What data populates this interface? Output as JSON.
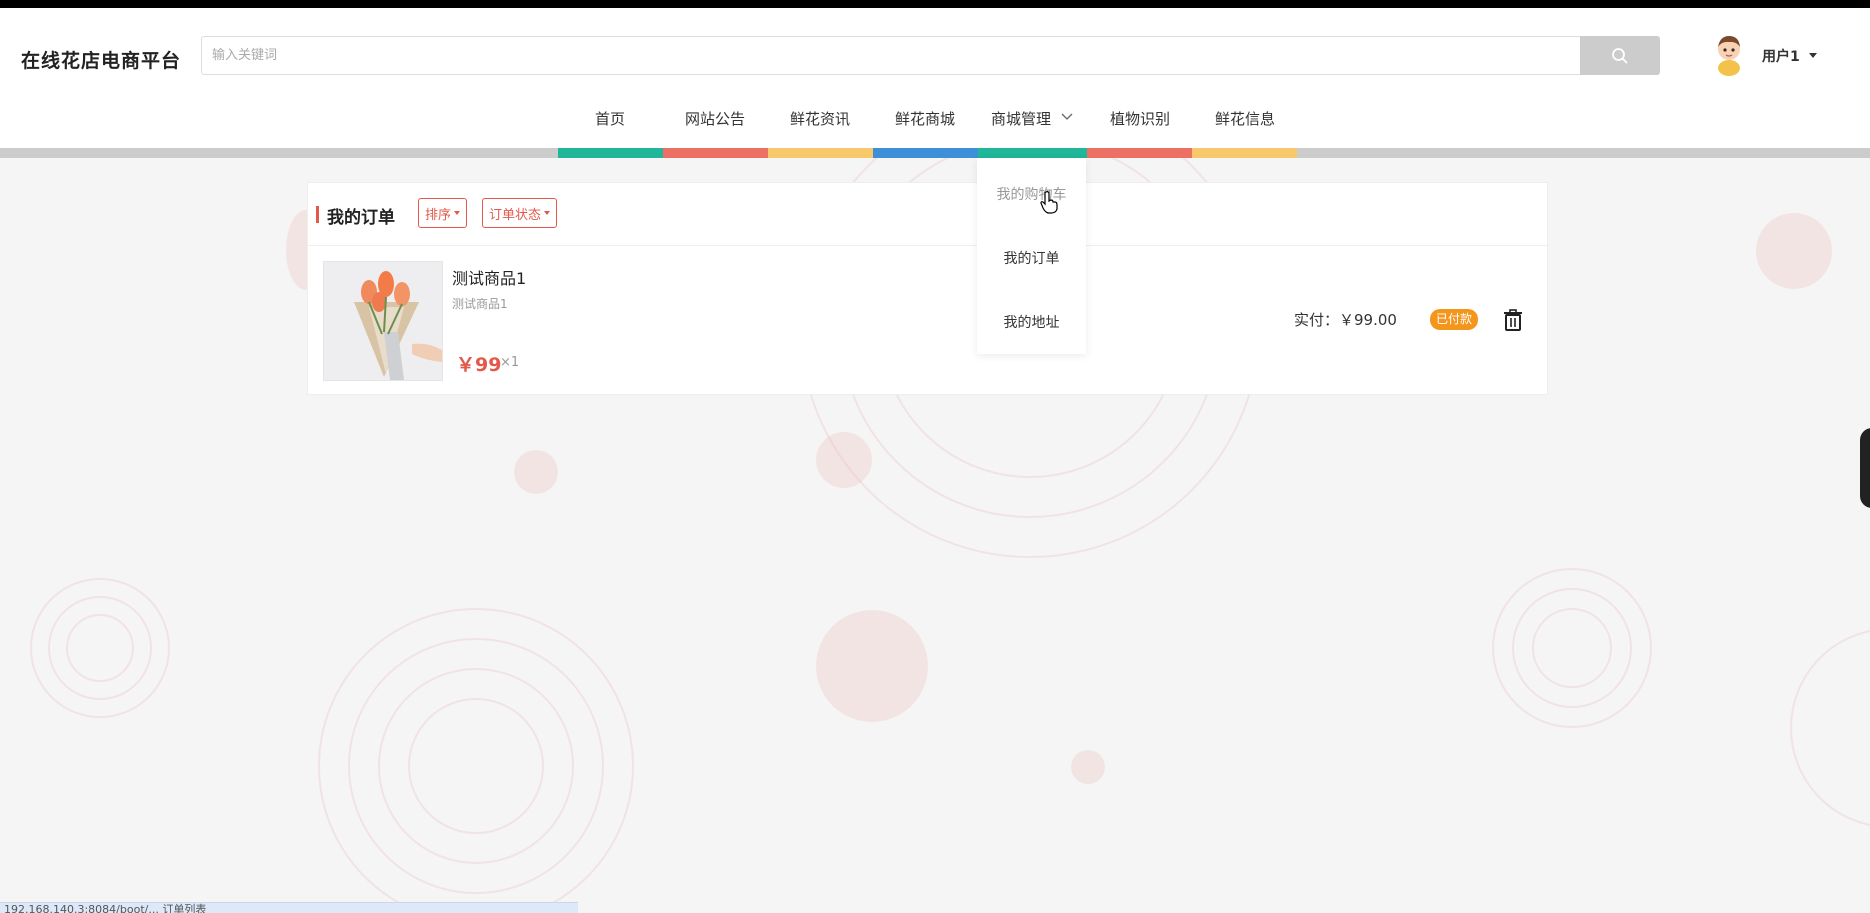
{
  "header": {
    "site_title": "在线花店电商平台",
    "search_placeholder": "输入关键词",
    "user_name": "用户1"
  },
  "nav": {
    "items": [
      {
        "label": "首页",
        "color": "#1fb69a"
      },
      {
        "label": "网站公告",
        "color": "#ec7063"
      },
      {
        "label": "鲜花资讯",
        "color": "#f7c96a"
      },
      {
        "label": "鲜花商城",
        "color": "#3d8fd8"
      },
      {
        "label": "商城管理",
        "color": "#1fb69a"
      },
      {
        "label": "植物识别",
        "color": "#ec7063"
      },
      {
        "label": "鲜花信息",
        "color": "#f7c96a"
      }
    ]
  },
  "dropdown": {
    "items": [
      {
        "label": "我的购物车"
      },
      {
        "label": "我的订单"
      },
      {
        "label": "我的地址"
      }
    ]
  },
  "orders": {
    "title": "我的订单",
    "sort_label": "排序",
    "status_filter_label": "订单状态",
    "list": [
      {
        "name": "测试商品1",
        "subtitle": "测试商品1",
        "price": "￥99",
        "quantity": "×1",
        "paid": "实付：￥99.00",
        "status": "已付款"
      }
    ]
  },
  "colors": {
    "accent": "#e2594b",
    "status_badge": "#f5961c"
  },
  "statusbar": {
    "url": "192.168.140.3:8084/boot/...  订单列表"
  }
}
